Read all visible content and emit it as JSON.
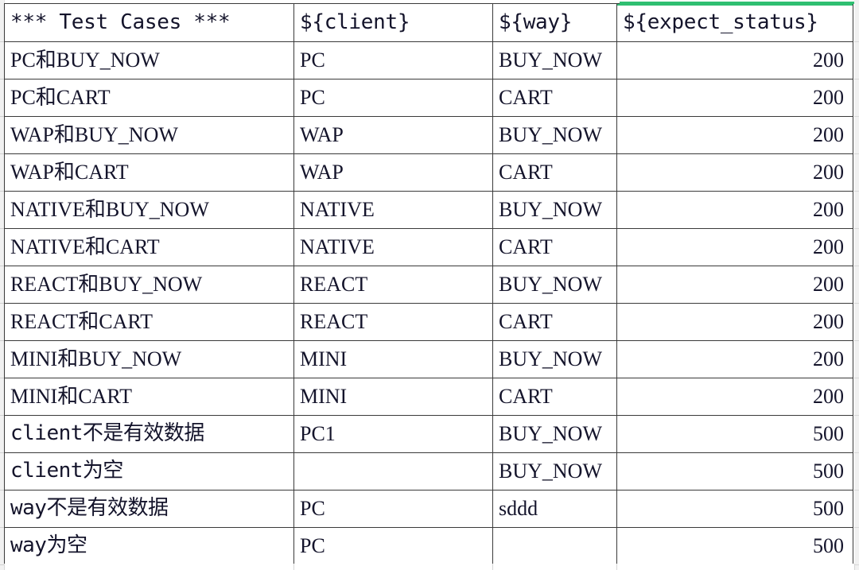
{
  "sheet": {
    "selection_accent": "#2fbf71",
    "grid_line_color": "#3a3a3a",
    "text_color": "#14142b",
    "background": "#ffffff"
  },
  "table": {
    "headers": [
      "*** Test Cases ***",
      "${client}",
      "${way}",
      "${expect_status}"
    ],
    "rows": [
      {
        "test_case": "PC和BUY_NOW",
        "client": "PC",
        "way": "BUY_NOW",
        "expect_status": "200"
      },
      {
        "test_case": "PC和CART",
        "client": "PC",
        "way": "CART",
        "expect_status": "200"
      },
      {
        "test_case": "WAP和BUY_NOW",
        "client": "WAP",
        "way": "BUY_NOW",
        "expect_status": "200"
      },
      {
        "test_case": "WAP和CART",
        "client": "WAP",
        "way": "CART",
        "expect_status": "200"
      },
      {
        "test_case": "NATIVE和BUY_NOW",
        "client": "NATIVE",
        "way": "BUY_NOW",
        "expect_status": "200"
      },
      {
        "test_case": "NATIVE和CART",
        "client": "NATIVE",
        "way": "CART",
        "expect_status": "200"
      },
      {
        "test_case": "REACT和BUY_NOW",
        "client": "REACT",
        "way": "BUY_NOW",
        "expect_status": "200"
      },
      {
        "test_case": "REACT和CART",
        "client": "REACT",
        "way": "CART",
        "expect_status": "200"
      },
      {
        "test_case": "MINI和BUY_NOW",
        "client": "MINI",
        "way": "BUY_NOW",
        "expect_status": "200"
      },
      {
        "test_case": "MINI和CART",
        "client": "MINI",
        "way": "CART",
        "expect_status": "200"
      },
      {
        "test_case": "client不是有效数据",
        "client": "PC1",
        "way": "BUY_NOW",
        "expect_status": "500"
      },
      {
        "test_case": "client为空",
        "client": "",
        "way": "BUY_NOW",
        "expect_status": "500"
      },
      {
        "test_case": "way不是有效数据",
        "client": "PC",
        "way": "sddd",
        "expect_status": "500"
      },
      {
        "test_case": "way为空",
        "client": "PC",
        "way": "",
        "expect_status": "500"
      }
    ]
  }
}
